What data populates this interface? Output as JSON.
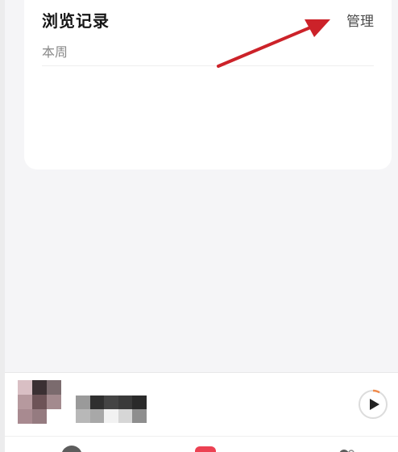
{
  "history": {
    "title": "浏览记录",
    "manage_label": "管理",
    "subtitle": "本周"
  },
  "colors": {
    "annotation_arrow": "#cc2229",
    "accent": "#ec4152",
    "play_progress": "#f08a4b"
  },
  "player": {
    "cover_icon": "pixelated-album-cover",
    "track_icon": "pixelated-track-title",
    "play_icon": "play-icon"
  },
  "tabs": [
    {
      "icon": "home-icon"
    },
    {
      "icon": "music-icon"
    },
    {
      "icon": "profile-icon"
    }
  ]
}
